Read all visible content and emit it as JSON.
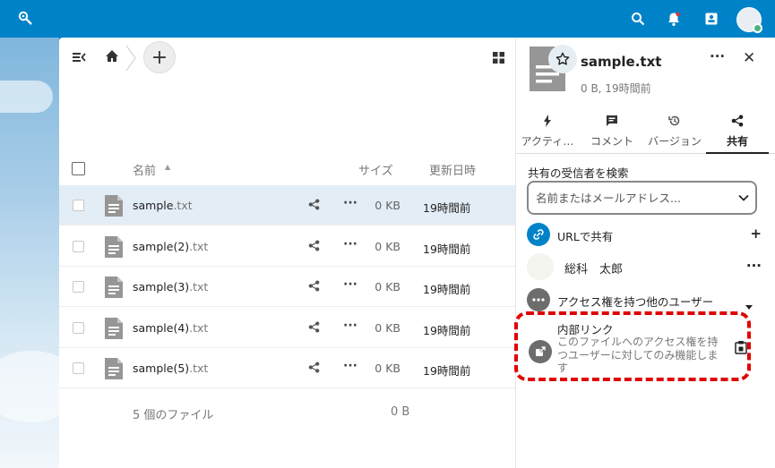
{
  "colors": {
    "brand": "#0082c9",
    "highlight": "#e00000",
    "selected_row": "#e3edf6"
  },
  "header": {
    "icons": [
      "search-icon",
      "bell-icon",
      "contacts-icon"
    ]
  },
  "files": {
    "columns": {
      "name": "名前",
      "size": "サイズ",
      "modified": "更新日時"
    },
    "rows": [
      {
        "base": "sample",
        "ext": ".txt",
        "size": "0 KB",
        "modified": "19時間前"
      },
      {
        "base": "sample(2)",
        "ext": ".txt",
        "size": "0 KB",
        "modified": "19時間前"
      },
      {
        "base": "sample(3)",
        "ext": ".txt",
        "size": "0 KB",
        "modified": "19時間前"
      },
      {
        "base": "sample(4)",
        "ext": ".txt",
        "size": "0 KB",
        "modified": "19時間前"
      },
      {
        "base": "sample(5)",
        "ext": ".txt",
        "size": "0 KB",
        "modified": "19時間前"
      }
    ],
    "summary": "5 個のファイル",
    "summary_size": "0 B",
    "add_label": "+",
    "more_label": "···"
  },
  "sidebar": {
    "title": "sample.txt",
    "subtitle": "0 B, 19時間前",
    "more_label": "···",
    "close_label": "✕",
    "tabs": [
      {
        "label": "アクティ…",
        "icon": "activity-icon"
      },
      {
        "label": "コメント",
        "icon": "comment-icon"
      },
      {
        "label": "バージョン",
        "icon": "history-icon"
      },
      {
        "label": "共有",
        "icon": "share-icon"
      }
    ],
    "sharing": {
      "search_label": "共有の受信者を検索",
      "search_placeholder": "名前またはメールアドレス...",
      "url_share_label": "URLで共有",
      "url_share_action": "+",
      "user_name": "総科　太郎",
      "user_action": "···",
      "others_label": "アクセス権を持つ他のユーザー",
      "internal_link_title": "内部リンク",
      "internal_link_desc": "このファイルへのアクセス権を持つユーザーに対してのみ機能します"
    }
  }
}
